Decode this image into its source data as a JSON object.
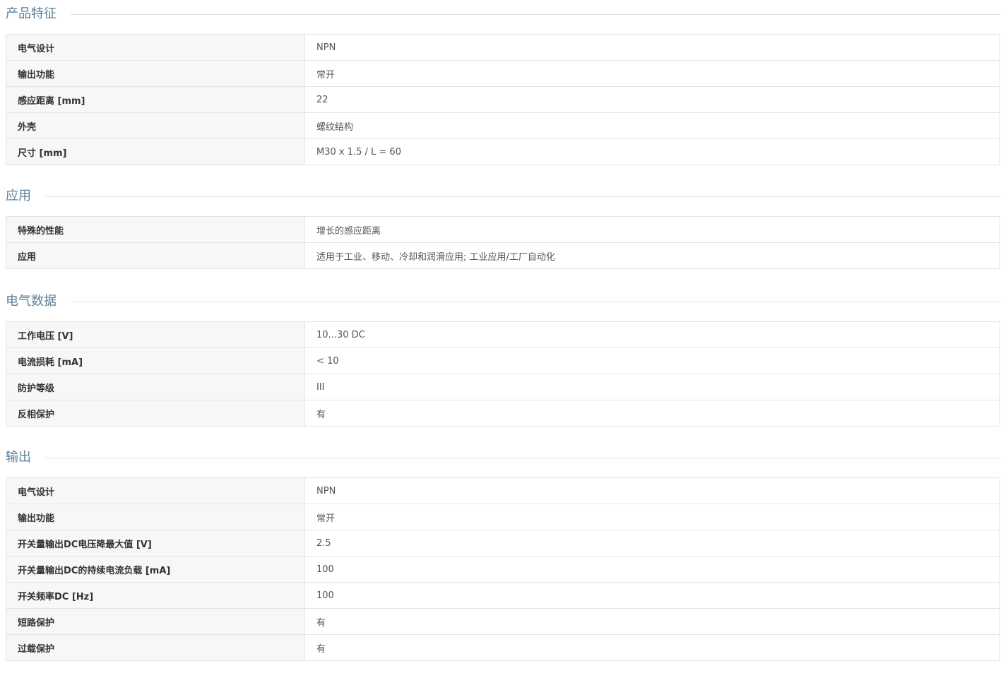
{
  "sections": [
    {
      "title": "产品特征",
      "rows": [
        {
          "label": "电气设计",
          "value": "NPN"
        },
        {
          "label": "输出功能",
          "value": "常开"
        },
        {
          "label": "感应距离 [mm]",
          "value": "22"
        },
        {
          "label": "外壳",
          "value": "螺纹结构"
        },
        {
          "label": "尺寸 [mm]",
          "value": "M30 x 1.5 / L = 60"
        }
      ]
    },
    {
      "title": "应用",
      "rows": [
        {
          "label": "特殊的性能",
          "value": "增长的感应距离"
        },
        {
          "label": "应用",
          "value": "适用于工业、移动、冷却和润滑应用; 工业应用/工厂自动化"
        }
      ]
    },
    {
      "title": "电气数据",
      "rows": [
        {
          "label": "工作电压 [V]",
          "value": "10...30 DC"
        },
        {
          "label": "电流损耗 [mA]",
          "value": "< 10"
        },
        {
          "label": "防护等级",
          "value": "III"
        },
        {
          "label": "反相保护",
          "value": "有"
        }
      ]
    },
    {
      "title": "输出",
      "rows": [
        {
          "label": "电气设计",
          "value": "NPN"
        },
        {
          "label": "输出功能",
          "value": "常开"
        },
        {
          "label": "开关量输出DC电压降最大值 [V]",
          "value": "2.5"
        },
        {
          "label": "开关量输出DC的持续电流负载 [mA]",
          "value": "100"
        },
        {
          "label": "开关频率DC [Hz]",
          "value": "100"
        },
        {
          "label": "短路保护",
          "value": "有"
        },
        {
          "label": "过载保护",
          "value": "有"
        }
      ]
    }
  ]
}
